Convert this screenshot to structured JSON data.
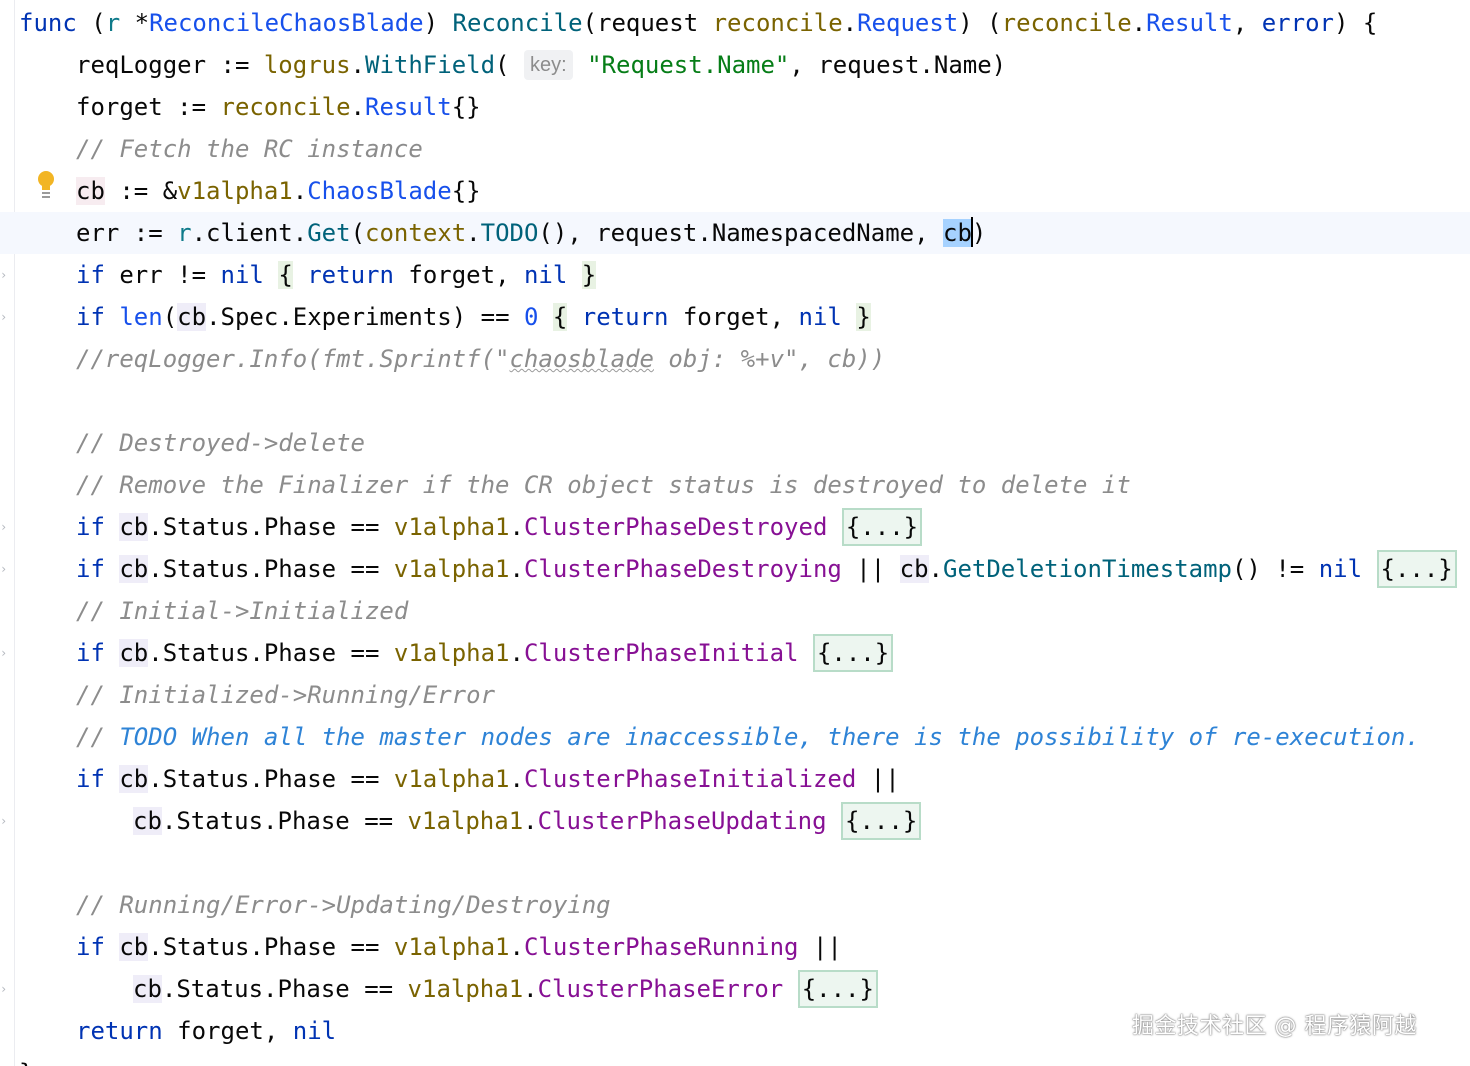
{
  "editor": {
    "language": "Go",
    "colors": {
      "keyword": "#0033b3",
      "function": "#00627a",
      "type": "#1750eb",
      "package": "#7a6300",
      "string": "#067d17",
      "comment": "#8c8c8c",
      "todo_comment": "#2e83d6",
      "constant": "#871094",
      "caret_line_background": "#f5f8fe",
      "selection": "#a6d2ff",
      "folded_block_border": "#b8dcc8"
    },
    "param_hint": "key:",
    "folded_placeholder": "{...}",
    "intention_icon": "lightbulb-icon"
  },
  "lines": {
    "l1": {
      "func": "func",
      "open": " (",
      "r": "r",
      "star": " *",
      "recvType": "ReconcileChaosBlade",
      "close": ")",
      "name": " Reconcile",
      "p1": "(request ",
      "pkg1": "reconcile",
      "dot1": ".",
      "t1": "Request",
      "p2": ") (",
      "pkg2": "reconcile",
      "dot2": ".",
      "t2": "Result",
      "p3": ", ",
      "t3": "error",
      "p4": ") {"
    },
    "l2": {
      "a": "reqLogger := ",
      "pkg": "logrus",
      "dot": ".",
      "fn": "WithField",
      "b": "( ",
      "str": "\"Request.Name\"",
      "c": ", request.Name)"
    },
    "l3": {
      "a": "forget := ",
      "pkg": "reconcile",
      "dot": ".",
      "t": "Result",
      "b": "{}"
    },
    "l4": {
      "cmt": "// Fetch the RC instance"
    },
    "l5": {
      "cb": "cb",
      "a": " := &",
      "pkg": "v1alpha1",
      "dot": ".",
      "t": "ChaosBlade",
      "b": "{}"
    },
    "l6": {
      "a": "err := ",
      "r": "r",
      "b": ".client.",
      "fn": "Get",
      "c": "(",
      "pkg": "context",
      "dot": ".",
      "fn2": "TODO",
      "d": "(), request.NamespacedName, ",
      "cb": "cb",
      "e": ")"
    },
    "l7": {
      "if": "if",
      "a": " err != ",
      "nil1": "nil",
      "sp": " ",
      "ob": "{",
      "sp2": " ",
      "ret": "return",
      "b": " forget, ",
      "nil2": "nil",
      "sp3": " ",
      "cb": "}"
    },
    "l8": {
      "if": "if",
      "sp": " ",
      "len": "len",
      "a": "(",
      "cbv": "cb",
      "b": ".Spec.Experiments) == ",
      "zero": "0",
      "sp2": " ",
      "ob": "{",
      "sp3": " ",
      "ret": "return",
      "c": " forget, ",
      "nil": "nil",
      "sp4": " ",
      "cb": "}"
    },
    "l9": {
      "a": "//reqLogger.Info(fmt.Sprintf(\"",
      "sq": "chaosblade",
      "b": " obj: %+v\", cb))"
    },
    "l11": {
      "cmt": "// Destroyed->delete"
    },
    "l12": {
      "cmt": "// Remove the Finalizer if the CR object status is destroyed to delete it"
    },
    "l13": {
      "if": "if",
      "sp": " ",
      "cb": "cb",
      "a": ".Status.Phase == ",
      "pkg": "v1alpha1",
      "dot": ".",
      "const": "ClusterPhaseDestroyed",
      "sp2": " "
    },
    "l14": {
      "if": "if",
      "sp": " ",
      "cb": "cb",
      "a": ".Status.Phase == ",
      "pkg": "v1alpha1",
      "dot": ".",
      "const": "ClusterPhaseDestroying",
      "b": " || ",
      "cb2": "cb",
      "dot2": ".",
      "fn": "GetDeletionTimestamp",
      "c": "() != ",
      "nil": "nil",
      "sp2": " "
    },
    "l15": {
      "cmt": "// Initial->Initialized"
    },
    "l16": {
      "if": "if",
      "sp": " ",
      "cb": "cb",
      "a": ".Status.Phase == ",
      "pkg": "v1alpha1",
      "dot": ".",
      "const": "ClusterPhaseInitial",
      "sp2": " "
    },
    "l17": {
      "cmt": "// Initialized->Running/Error"
    },
    "l18": {
      "cmt": "// ",
      "todo": "TODO When all the master nodes are inaccessible, there is the possibility of re-execution."
    },
    "l19": {
      "if": "if",
      "sp": " ",
      "cb": "cb",
      "a": ".Status.Phase == ",
      "pkg": "v1alpha1",
      "dot": ".",
      "const": "ClusterPhaseInitialized",
      "b": " ||"
    },
    "l20": {
      "cb": "cb",
      "a": ".Status.Phase == ",
      "pkg": "v1alpha1",
      "dot": ".",
      "const": "ClusterPhaseUpdating",
      "sp": " "
    },
    "l22": {
      "cmt": "// Running/Error->Updating/Destroying"
    },
    "l23": {
      "if": "if",
      "sp": " ",
      "cb": "cb",
      "a": ".Status.Phase == ",
      "pkg": "v1alpha1",
      "dot": ".",
      "const": "ClusterPhaseRunning",
      "b": " ||"
    },
    "l24": {
      "cb": "cb",
      "a": ".Status.Phase == ",
      "pkg": "v1alpha1",
      "dot": ".",
      "const": "ClusterPhaseError",
      "sp": " "
    },
    "l25": {
      "ret": "return",
      "a": " forget, ",
      "nil": "nil"
    },
    "l26": {
      "a": "}"
    }
  },
  "watermark": "掘金技术社区 @ 程序猿阿越"
}
